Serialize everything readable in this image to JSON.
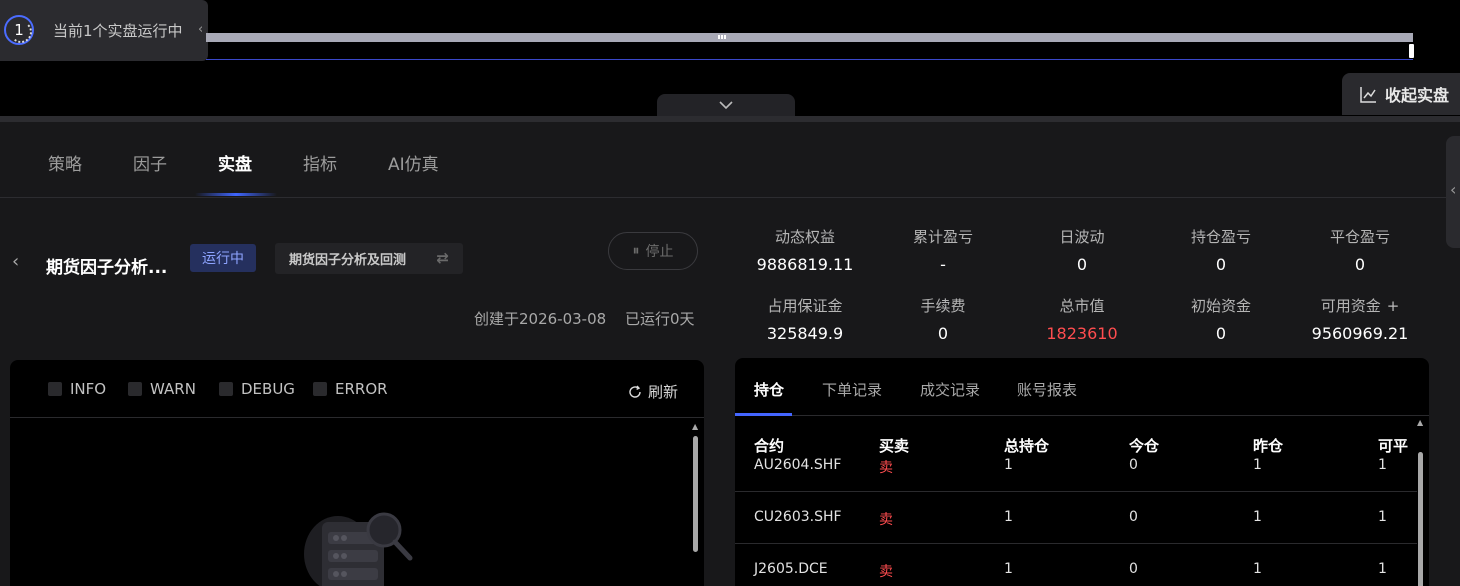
{
  "run_badge": {
    "count": "1",
    "text": "当前1个实盘运行中"
  },
  "fold_button": {
    "label": "收起实盘"
  },
  "tabs": [
    "策略",
    "因子",
    "实盘",
    "指标",
    "AI仿真"
  ],
  "strategy": {
    "name": "期货因子分析...",
    "status": "运行中",
    "sub_label": "期货因子分析及回测",
    "stop_label": "停止",
    "created": "创建于2026-03-08",
    "running": "已运行0天"
  },
  "stats": {
    "dynamic_equity": {
      "label": "动态权益",
      "value": "9886819.11"
    },
    "cumulative_pnl": {
      "label": "累计盈亏",
      "value": "-"
    },
    "daily_volatility": {
      "label": "日波动",
      "value": "0"
    },
    "position_pnl": {
      "label": "持仓盈亏",
      "value": "0"
    },
    "close_pnl": {
      "label": "平仓盈亏",
      "value": "0"
    },
    "margin": {
      "label": "占用保证金",
      "value": "325849.9"
    },
    "fee": {
      "label": "手续费",
      "value": "0"
    },
    "market_value": {
      "label": "总市值",
      "value": "1823610"
    },
    "initial_capital": {
      "label": "初始资金",
      "value": "0"
    },
    "available_funds": {
      "label": "可用资金",
      "value": "9560969.21",
      "plus": "+"
    }
  },
  "log": {
    "filters": [
      "INFO",
      "WARN",
      "DEBUG",
      "ERROR"
    ],
    "refresh_label": "刷新"
  },
  "positions": {
    "tabs": [
      "持仓",
      "下单记录",
      "成交记录",
      "账号报表"
    ],
    "columns": [
      "合约",
      "买卖",
      "总持仓",
      "今仓",
      "昨仓",
      "可平"
    ],
    "rows": [
      {
        "contract": "AU2604.SHF",
        "side": "卖",
        "total": "1",
        "today": "0",
        "yesterday": "1",
        "closable": "1"
      },
      {
        "contract": "CU2603.SHF",
        "side": "卖",
        "total": "1",
        "today": "0",
        "yesterday": "1",
        "closable": "1"
      },
      {
        "contract": "J2605.DCE",
        "side": "卖",
        "total": "1",
        "today": "0",
        "yesterday": "1",
        "closable": "1"
      }
    ]
  },
  "colors": {
    "accent": "#4466ff",
    "sell": "#ff4d4f",
    "status_bg": "#25305e"
  }
}
